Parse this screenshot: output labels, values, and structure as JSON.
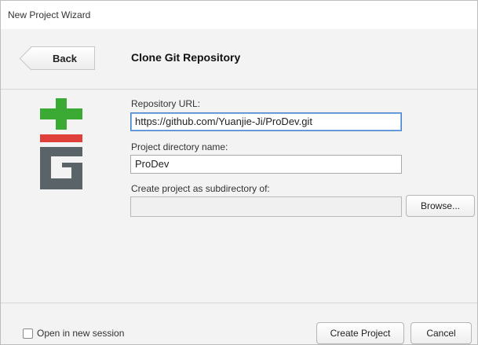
{
  "window": {
    "title": "New Project Wizard"
  },
  "header": {
    "back_label": "Back",
    "page_title": "Clone Git Repository"
  },
  "form": {
    "repo_url": {
      "label": "Repository URL:",
      "value": "https://github.com/Yuanjie-Ji/ProDev.git"
    },
    "project_dir": {
      "label": "Project directory name:",
      "value": "ProDev"
    },
    "subdirectory": {
      "label": "Create project as subdirectory of:",
      "value": "",
      "browse_label": "Browse..."
    }
  },
  "footer": {
    "open_new_session_label": "Open in new session",
    "open_new_session_checked": false,
    "create_label": "Create Project",
    "cancel_label": "Cancel"
  },
  "colors": {
    "git_green": "#3aaa35",
    "git_red": "#e0403a",
    "git_gray": "#5a6468",
    "focus_blue": "#4a86c8"
  }
}
